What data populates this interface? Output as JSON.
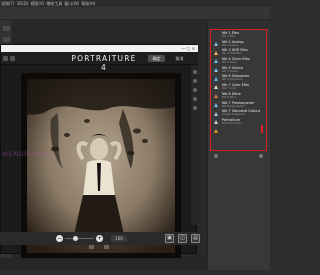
{
  "menubar": {
    "items": [
      "滤镜(T)",
      "3D(D)",
      "视图(V)",
      "增效工具",
      "窗口(W)",
      "帮助(H)"
    ]
  },
  "watermark": {
    "text": "WENDRUSHUI"
  },
  "plugin": {
    "title": "PORTRAITURE 4",
    "ok_label": "确定",
    "cancel_label": "取消"
  },
  "zoom": {
    "value": "100",
    "level": 0.35
  },
  "statusbar": {
    "text": ""
  },
  "panel": {
    "tab_label": "",
    "actions": [
      {
        "name": "Nik 1 Efex",
        "sub": "Nik 1 Efex",
        "icon": "nik-efex-icon",
        "color": "#7fbfe6"
      },
      {
        "name": "Nik 2 Analog",
        "sub": "Nik 2 Analog",
        "icon": "nik-analog-icon",
        "color": "#e6b25a"
      },
      {
        "name": "Nik 3 HDR Efex",
        "sub": "Nik 3 HDR Efex",
        "icon": "nik-hdr-icon",
        "color": "#6fb8e0"
      },
      {
        "name": "Nik 4 Silver Efex",
        "sub": "Nik 4 Silver",
        "icon": "nik-silver-icon",
        "color": "#7bc4e8"
      },
      {
        "name": "Nik 5 Viveza",
        "sub": "Nik 5 Viveza",
        "icon": "nik-viveza-icon",
        "color": "#5fb0de"
      },
      {
        "name": "Nik 6 Sharpener",
        "sub": "Nik 6 Sharpener",
        "icon": "nik-sharpener-icon",
        "color": "#d9d9d9"
      },
      {
        "name": "Nik 7 Color Efex",
        "sub": "Nik 7 Color",
        "icon": "nik-color-icon",
        "color": "#e07a3a"
      },
      {
        "name": "Nik 8 Dfine",
        "sub": "Nik 8 Dfine",
        "icon": "nik-dfine-icon",
        "color": "#6bb9e3"
      },
      {
        "name": "Nik 7 Presharpener",
        "sub": "Nik Presharpener",
        "icon": "nik-presharpener-icon",
        "color": "#9ccbe8"
      },
      {
        "name": "Nik 7 Standard Output",
        "sub": "Output sharpener",
        "icon": "nik-output-icon",
        "color": "#cccccc"
      },
      {
        "name": "Portraiture",
        "sub": "Portraiture skin",
        "icon": "portraiture-icon",
        "color": "#e39a2a"
      }
    ]
  }
}
